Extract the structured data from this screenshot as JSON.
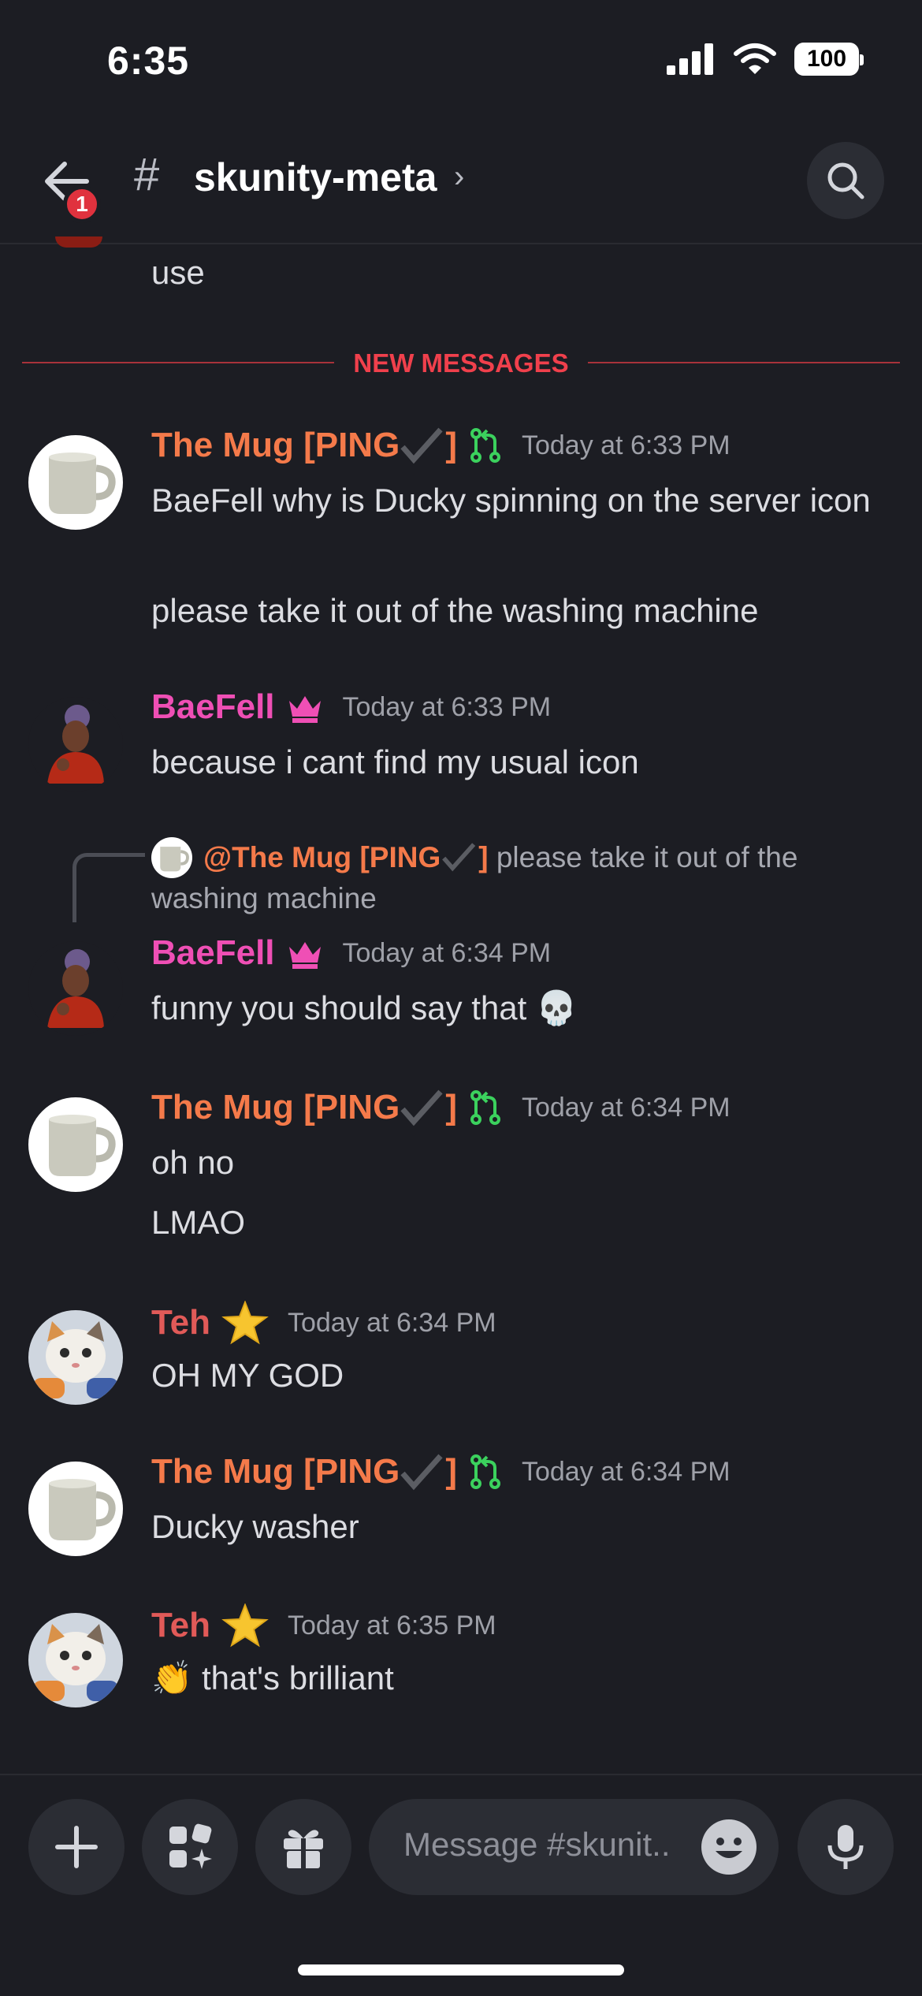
{
  "status_bar": {
    "time": "6:35",
    "battery": "100"
  },
  "header": {
    "hash_symbol": "#",
    "channel": "skunity-meta",
    "chevron": "›",
    "unread_badge": "1"
  },
  "cut_message": {
    "text": "use"
  },
  "divider": {
    "label": "NEW MESSAGES"
  },
  "messages": [
    {
      "author": "The Mug [PING",
      "author_suffix": "]",
      "timestamp": "Today at 6:33 PM",
      "lines": [
        "BaeFell why is Ducky spinning on the server icon",
        "please take it out of the washing machine"
      ]
    },
    {
      "author": "BaeFell",
      "timestamp": "Today at 6:33 PM",
      "lines": [
        "because i cant find my usual icon"
      ]
    },
    {
      "reply": {
        "mention": "@The Mug [PING",
        "mention_suffix": "]",
        "text": "please take it out of the washing machine"
      },
      "author": "BaeFell",
      "timestamp": "Today at 6:34 PM",
      "lines": [
        "funny you should say that 💀"
      ]
    },
    {
      "author": "The Mug [PING",
      "author_suffix": "]",
      "timestamp": "Today at 6:34 PM",
      "lines": [
        "oh no",
        "LMAO"
      ]
    },
    {
      "author": "Teh",
      "timestamp": "Today at 6:34 PM",
      "lines": [
        "OH MY GOD"
      ]
    },
    {
      "author": "The Mug [PING",
      "author_suffix": "]",
      "timestamp": "Today at 6:34 PM",
      "lines": [
        "Ducky washer"
      ]
    },
    {
      "author": "Teh",
      "timestamp": "Today at 6:35 PM",
      "lines": [
        "👏 that's brilliant"
      ]
    }
  ],
  "composer": {
    "placeholder": "Message #skunit.."
  },
  "colors": {
    "background": "#1c1d23",
    "mug_name": "#f47a4a",
    "bae_name": "#ef4fb5",
    "teh_name": "#e15a58",
    "new_messages": "#f0404c",
    "merge_icon": "#3bd15d"
  },
  "icons": [
    "signal-icon",
    "wifi-icon",
    "battery-icon",
    "back-arrow-icon",
    "search-icon",
    "checkmark-icon",
    "git-merge-icon",
    "crown-icon",
    "star-icon",
    "plus-icon",
    "apps-icon",
    "gift-icon",
    "emoji-icon",
    "microphone-icon"
  ]
}
